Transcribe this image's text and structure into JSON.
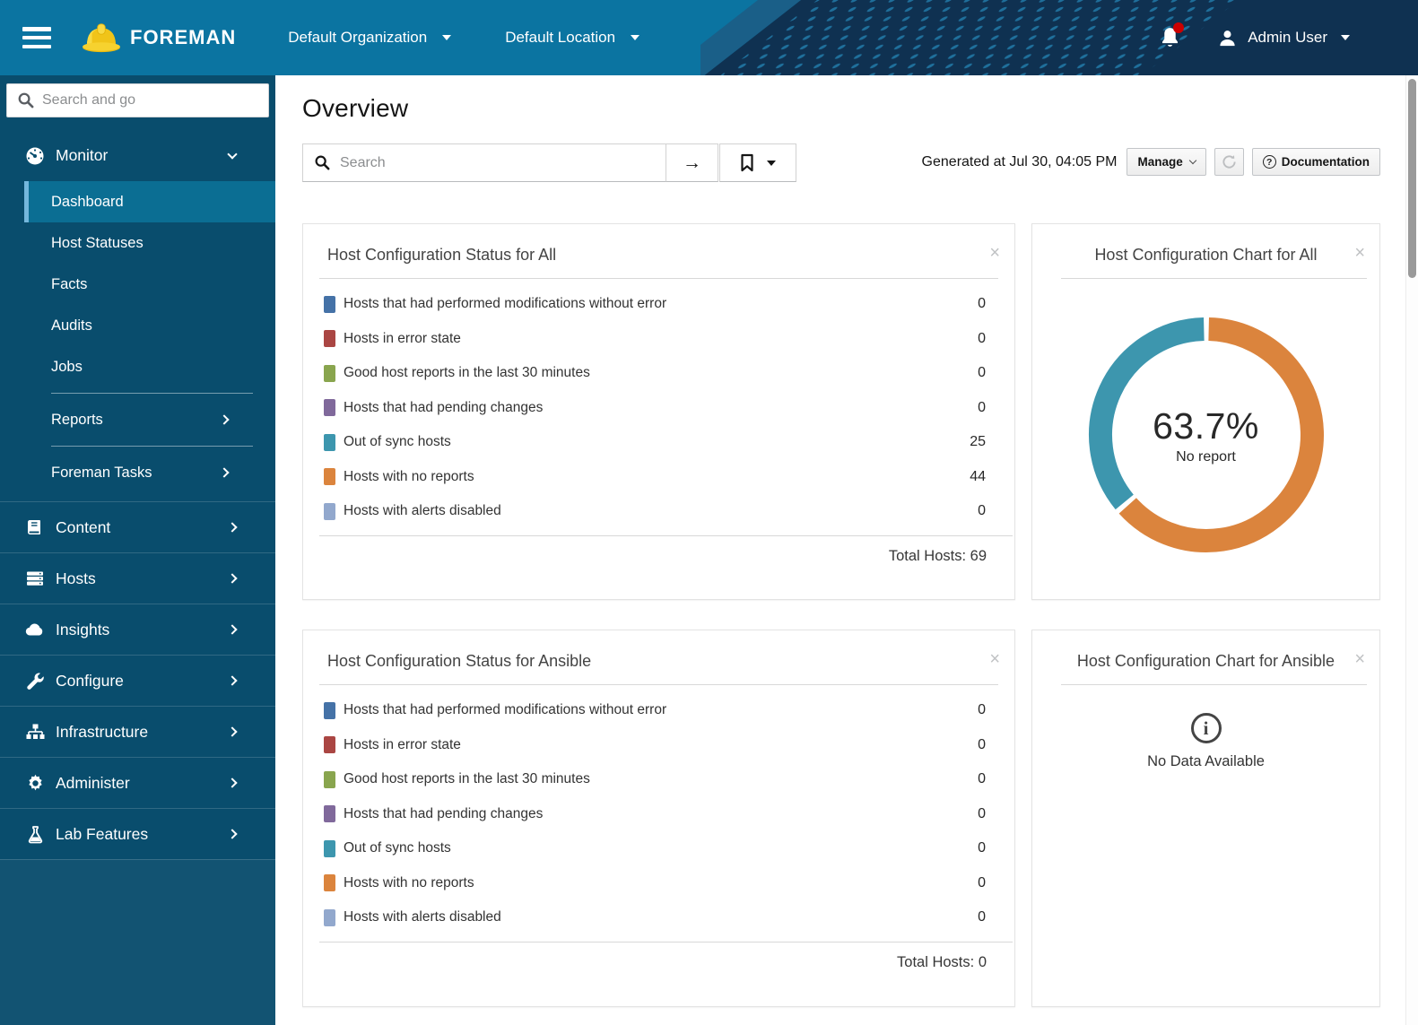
{
  "masthead": {
    "brand": "FOREMAN",
    "org_selector": "Default Organization",
    "location_selector": "Default Location",
    "user": "Admin User"
  },
  "sidebar": {
    "search_placeholder": "Search and go",
    "monitor_label": "Monitor",
    "monitor_items": {
      "dashboard": "Dashboard",
      "host_statuses": "Host Statuses",
      "facts": "Facts",
      "audits": "Audits",
      "jobs": "Jobs",
      "reports": "Reports",
      "foreman_tasks": "Foreman Tasks"
    },
    "sections": {
      "content": "Content",
      "hosts": "Hosts",
      "insights": "Insights",
      "configure": "Configure",
      "infrastructure": "Infrastructure",
      "administer": "Administer",
      "lab_features": "Lab Features"
    }
  },
  "main": {
    "title": "Overview",
    "search_placeholder": "Search",
    "generated_at": "Generated at Jul 30, 04:05 PM",
    "manage_label": "Manage",
    "documentation_label": "Documentation"
  },
  "cards": {
    "status_all": {
      "title": "Host Configuration Status for All",
      "rows": [
        {
          "label": "Hosts that had performed modifications without error",
          "value": "0",
          "color": "#4572A7"
        },
        {
          "label": "Hosts in error state",
          "value": "0",
          "color": "#AA4643"
        },
        {
          "label": "Good host reports in the last 30 minutes",
          "value": "0",
          "color": "#89A54E"
        },
        {
          "label": "Hosts that had pending changes",
          "value": "0",
          "color": "#80699B"
        },
        {
          "label": "Out of sync hosts",
          "value": "25",
          "color": "#3D96AE"
        },
        {
          "label": "Hosts with no reports",
          "value": "44",
          "color": "#DB843D"
        },
        {
          "label": "Hosts with alerts disabled",
          "value": "0",
          "color": "#92A8CD"
        }
      ],
      "total": "Total Hosts: 69"
    },
    "chart_all": {
      "title": "Host Configuration Chart for All",
      "center_value": "63.7%",
      "center_label": "No report"
    },
    "status_ansible": {
      "title": "Host Configuration Status for Ansible",
      "rows": [
        {
          "label": "Hosts that had performed modifications without error",
          "value": "0",
          "color": "#4572A7"
        },
        {
          "label": "Hosts in error state",
          "value": "0",
          "color": "#AA4643"
        },
        {
          "label": "Good host reports in the last 30 minutes",
          "value": "0",
          "color": "#89A54E"
        },
        {
          "label": "Hosts that had pending changes",
          "value": "0",
          "color": "#80699B"
        },
        {
          "label": "Out of sync hosts",
          "value": "0",
          "color": "#3D96AE"
        },
        {
          "label": "Hosts with no reports",
          "value": "0",
          "color": "#DB843D"
        },
        {
          "label": "Hosts with alerts disabled",
          "value": "0",
          "color": "#92A8CD"
        }
      ],
      "total": "Total Hosts: 0"
    },
    "chart_ansible": {
      "title": "Host Configuration Chart for Ansible",
      "empty_message": "No Data Available"
    }
  },
  "chart_data": [
    {
      "type": "pie",
      "title": "Host Configuration Chart for All",
      "series": [
        {
          "name": "No report",
          "percent": 63.7,
          "hosts": 44,
          "color": "#DB843D"
        },
        {
          "name": "Out of sync",
          "percent": 36.3,
          "hosts": 25,
          "color": "#3D96AE"
        }
      ],
      "center_label": "63.7%",
      "center_sublabel": "No report",
      "legend": "none"
    },
    {
      "type": "pie",
      "title": "Host Configuration Chart for Ansible",
      "series": [],
      "empty_message": "No Data Available"
    }
  ],
  "icons": {
    "hamburger-icon": "three-bars",
    "foreman-logo-icon": "yellow hard hat",
    "bell-icon": "notification bell with red dot",
    "user-icon": "person silhouette",
    "search-icon": "magnifier",
    "monitor-icon": "tachometer",
    "content-icon": "book",
    "hosts-icon": "server stack",
    "insights-icon": "cloud",
    "configure-icon": "wrench",
    "infrastructure-icon": "sitemap",
    "administer-icon": "gear",
    "lab-features-icon": "flask",
    "go-icon": "arrow-right",
    "bookmark-icon": "bookmark outline",
    "refresh-icon": "sync arrows",
    "question-icon": "question in circle",
    "info-icon": "i in circle",
    "close-icon": "x"
  },
  "colors": {
    "masthead_teal": "#0b74a1",
    "masthead_navy": "#0f3151",
    "sidebar_bg": "#094d6d",
    "sidebar_active_bg": "#0b6e93",
    "sidebar_active_border": "#74b7dc",
    "notification_dot": "#cc0000"
  }
}
